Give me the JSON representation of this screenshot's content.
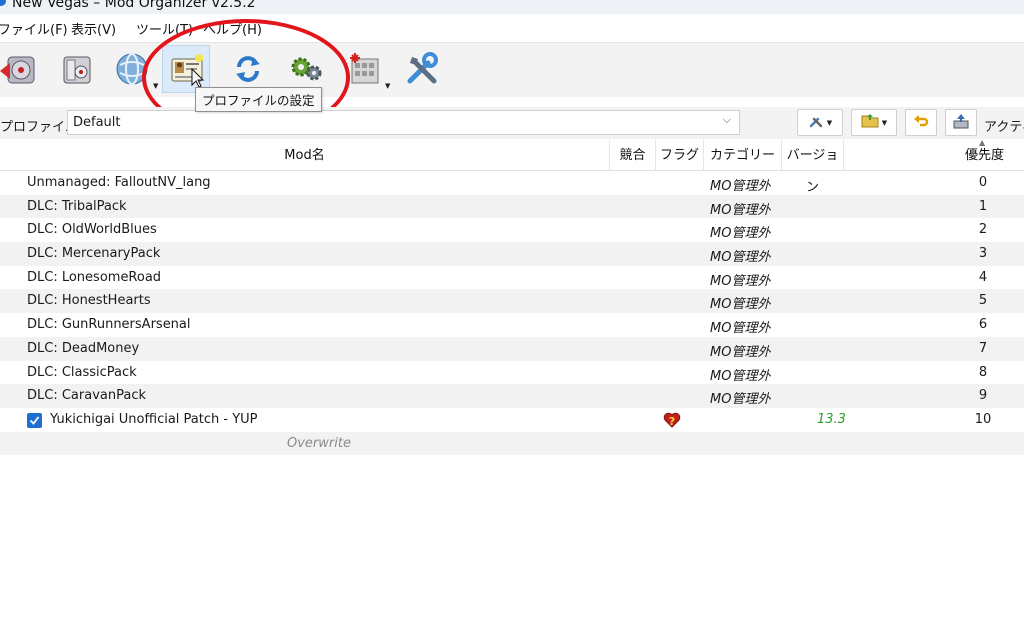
{
  "window": {
    "title": "New Vegas – Mod Organizer v2.5.2"
  },
  "menu": [
    "ファイル(F)",
    "表示(V)",
    "ツール(T)",
    "ヘルプ(H)"
  ],
  "toolbar": {
    "buttons": [
      {
        "icon": "install-archive-icon"
      },
      {
        "icon": "instance-manager-icon"
      },
      {
        "icon": "nexus-browser-icon"
      },
      {
        "icon": "profile-settings-icon"
      },
      {
        "icon": "refresh-icon"
      },
      {
        "icon": "settings-icon"
      },
      {
        "icon": "executables-icon"
      },
      {
        "icon": "tools-icon"
      }
    ],
    "tooltip": "プロファイルの設定"
  },
  "profile": {
    "label": "プロファイル",
    "value": "Default",
    "active_label": "アクティ"
  },
  "table": {
    "columns": [
      "Mod名",
      "競合",
      "フラグ",
      "カテゴリー",
      "バージョン",
      "優先度"
    ],
    "rows": [
      {
        "name": "Unmanaged: FalloutNV_lang",
        "category": "MO管理外",
        "priority": "0"
      },
      {
        "name": "DLC: TribalPack",
        "category": "MO管理外",
        "priority": "1"
      },
      {
        "name": "DLC: OldWorldBlues",
        "category": "MO管理外",
        "priority": "2"
      },
      {
        "name": "DLC: MercenaryPack",
        "category": "MO管理外",
        "priority": "3"
      },
      {
        "name": "DLC: LonesomeRoad",
        "category": "MO管理外",
        "priority": "4"
      },
      {
        "name": "DLC: HonestHearts",
        "category": "MO管理外",
        "priority": "5"
      },
      {
        "name": "DLC: GunRunnersArsenal",
        "category": "MO管理外",
        "priority": "6"
      },
      {
        "name": "DLC: DeadMoney",
        "category": "MO管理外",
        "priority": "7"
      },
      {
        "name": "DLC: ClassicPack",
        "category": "MO管理外",
        "priority": "8"
      },
      {
        "name": "DLC: CaravanPack",
        "category": "MO管理外",
        "priority": "9"
      },
      {
        "name": "Yukichigai Unofficial Patch - YUP",
        "checked": true,
        "flag_icon": "heart-question-icon",
        "version": "13.3",
        "priority": "10"
      }
    ],
    "overwrite_label": "Overwrite"
  },
  "colors": {
    "highlight": "#e3141c",
    "version": "#2a9d2a",
    "checkbox": "#1f6fd1"
  }
}
